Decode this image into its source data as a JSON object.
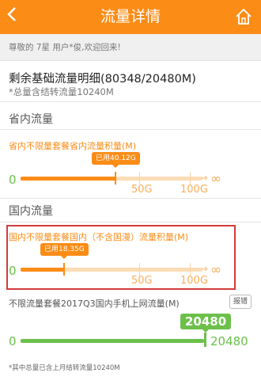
{
  "header": {
    "back_icon": "chevron-left-icon",
    "title": "流量详情",
    "home_icon": "home-icon"
  },
  "welcome": "尊敬的 7星 用户*俊,欢迎回来!",
  "base": {
    "title": "剩余基础流量明细(80348/20480M)",
    "note": "*总量含结转流量10240M"
  },
  "sections": {
    "province": "省内流量",
    "domestic": "国内流量"
  },
  "province_package": {
    "name": "省内不限量套餐省内流量积量(M)",
    "used_label": "已用40.12G",
    "used_gb": 40.12,
    "zero": "0",
    "tick_50": "50G",
    "tick_100": "100G",
    "infinity": "∞"
  },
  "domestic_package": {
    "name": "国内不限量套餐国内（不含国漫）流量积量(M)",
    "used_label": "已用18.35G",
    "used_gb": 18.35,
    "zero": "0",
    "tick_50": "50G",
    "tick_100": "100G",
    "infinity": "∞"
  },
  "unlimited": {
    "title": "不限流量套餐2017Q3国内手机上网流量(M)",
    "report_button": "报错",
    "value_label": "20480",
    "zero": "0",
    "total": "20480",
    "fraction": 1.0
  },
  "footnote": "*其中总量已含上月结转流量10240M",
  "colors": {
    "brand": "#fb8c16",
    "green": "#6cc04a",
    "highlight": "#d23b3b"
  }
}
